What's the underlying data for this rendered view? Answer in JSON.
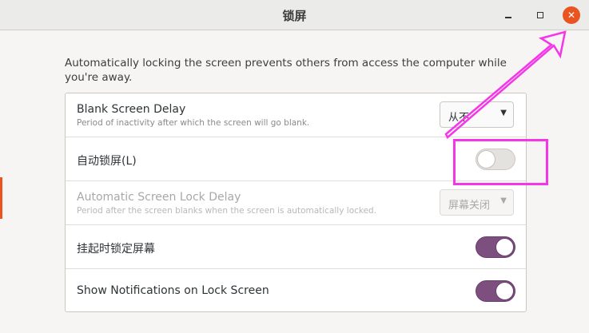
{
  "window": {
    "title": "锁屏",
    "close_glyph": "✕"
  },
  "description": "Automatically locking the screen prevents others from access the computer while you're away.",
  "rows": [
    {
      "label": "Blank Screen Delay",
      "sublabel": "Period of inactivity after which the screen will go blank.",
      "control": "combo",
      "value": "从不"
    },
    {
      "label": "自动锁屏(L)",
      "control": "switch",
      "state": "off"
    },
    {
      "label": "Automatic Screen Lock Delay",
      "sublabel": "Period after the screen blanks when the screen is automatically locked.",
      "control": "combo",
      "value": "屏幕关闭",
      "disabled": true
    },
    {
      "label": "挂起时锁定屏幕",
      "control": "switch",
      "state": "on"
    },
    {
      "label": "Show Notifications on Lock Screen",
      "control": "switch",
      "state": "on"
    }
  ],
  "colors": {
    "accent": "#e95420",
    "switch_on": "#7d4f7f",
    "annotation": "#f536e8"
  },
  "icons": {
    "minimize": "minimize-icon",
    "maximize": "maximize-icon",
    "close": "close-icon",
    "dropdown": "chevron-down-icon"
  }
}
